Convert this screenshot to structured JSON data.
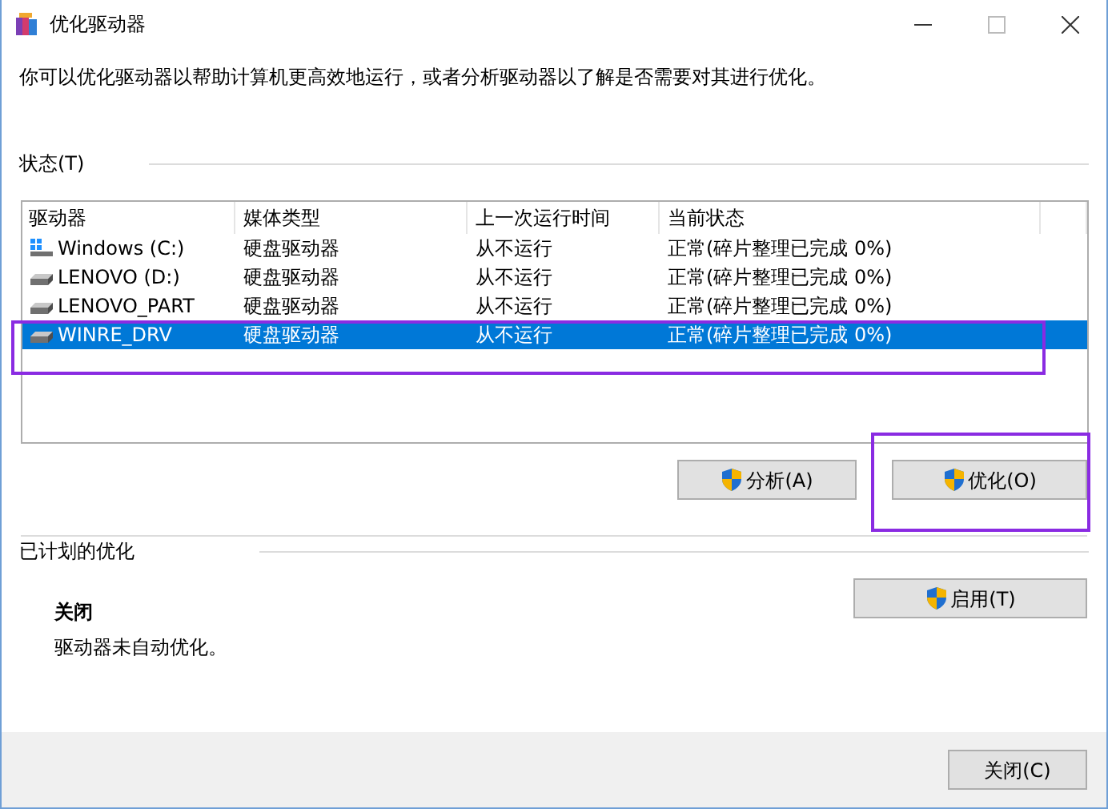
{
  "window": {
    "title": "优化驱动器"
  },
  "description": "你可以优化驱动器以帮助计算机更高效地运行，或者分析驱动器以了解是否需要对其进行优化。",
  "status_section": {
    "label": "状态(T)"
  },
  "table": {
    "columns": [
      "驱动器",
      "媒体类型",
      "上一次运行时间",
      "当前状态"
    ],
    "rows": [
      {
        "drive": "Windows (C:)",
        "kind": "system",
        "media": "硬盘驱动器",
        "last_run": "从不运行",
        "status": "正常(碎片整理已完成 0%)",
        "selected": false,
        "highlighted": false
      },
      {
        "drive": "LENOVO (D:)",
        "kind": "disk",
        "media": "硬盘驱动器",
        "last_run": "从不运行",
        "status": "正常(碎片整理已完成 0%)",
        "selected": false,
        "highlighted": false
      },
      {
        "drive": "LENOVO_PART",
        "kind": "disk",
        "media": "硬盘驱动器",
        "last_run": "从不运行",
        "status": "正常(碎片整理已完成 0%)",
        "selected": false,
        "highlighted": false
      },
      {
        "drive": "WINRE_DRV",
        "kind": "disk",
        "media": "硬盘驱动器",
        "last_run": "从不运行",
        "status": "正常(碎片整理已完成 0%)",
        "selected": true,
        "highlighted": true
      }
    ]
  },
  "actions": [
    {
      "label": "分析(A)",
      "highlighted": false
    },
    {
      "label": "优化(O)",
      "highlighted": true
    }
  ],
  "scheduled": {
    "label": "已计划的优化",
    "state": "关闭",
    "note": "驱动器未自动优化。",
    "button": "启用(T)"
  },
  "footer": {
    "button": "关闭(C)"
  }
}
